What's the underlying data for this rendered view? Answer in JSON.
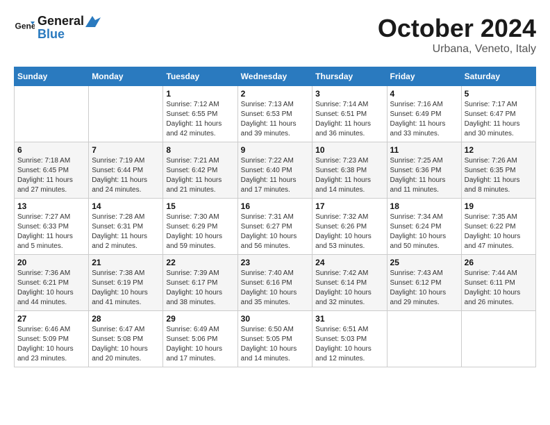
{
  "header": {
    "logo_line1": "General",
    "logo_line2": "Blue",
    "month": "October 2024",
    "location": "Urbana, Veneto, Italy"
  },
  "weekdays": [
    "Sunday",
    "Monday",
    "Tuesday",
    "Wednesday",
    "Thursday",
    "Friday",
    "Saturday"
  ],
  "weeks": [
    [
      {
        "day": "",
        "info": ""
      },
      {
        "day": "",
        "info": ""
      },
      {
        "day": "1",
        "info": "Sunrise: 7:12 AM\nSunset: 6:55 PM\nDaylight: 11 hours and 42 minutes."
      },
      {
        "day": "2",
        "info": "Sunrise: 7:13 AM\nSunset: 6:53 PM\nDaylight: 11 hours and 39 minutes."
      },
      {
        "day": "3",
        "info": "Sunrise: 7:14 AM\nSunset: 6:51 PM\nDaylight: 11 hours and 36 minutes."
      },
      {
        "day": "4",
        "info": "Sunrise: 7:16 AM\nSunset: 6:49 PM\nDaylight: 11 hours and 33 minutes."
      },
      {
        "day": "5",
        "info": "Sunrise: 7:17 AM\nSunset: 6:47 PM\nDaylight: 11 hours and 30 minutes."
      }
    ],
    [
      {
        "day": "6",
        "info": "Sunrise: 7:18 AM\nSunset: 6:45 PM\nDaylight: 11 hours and 27 minutes."
      },
      {
        "day": "7",
        "info": "Sunrise: 7:19 AM\nSunset: 6:44 PM\nDaylight: 11 hours and 24 minutes."
      },
      {
        "day": "8",
        "info": "Sunrise: 7:21 AM\nSunset: 6:42 PM\nDaylight: 11 hours and 21 minutes."
      },
      {
        "day": "9",
        "info": "Sunrise: 7:22 AM\nSunset: 6:40 PM\nDaylight: 11 hours and 17 minutes."
      },
      {
        "day": "10",
        "info": "Sunrise: 7:23 AM\nSunset: 6:38 PM\nDaylight: 11 hours and 14 minutes."
      },
      {
        "day": "11",
        "info": "Sunrise: 7:25 AM\nSunset: 6:36 PM\nDaylight: 11 hours and 11 minutes."
      },
      {
        "day": "12",
        "info": "Sunrise: 7:26 AM\nSunset: 6:35 PM\nDaylight: 11 hours and 8 minutes."
      }
    ],
    [
      {
        "day": "13",
        "info": "Sunrise: 7:27 AM\nSunset: 6:33 PM\nDaylight: 11 hours and 5 minutes."
      },
      {
        "day": "14",
        "info": "Sunrise: 7:28 AM\nSunset: 6:31 PM\nDaylight: 11 hours and 2 minutes."
      },
      {
        "day": "15",
        "info": "Sunrise: 7:30 AM\nSunset: 6:29 PM\nDaylight: 10 hours and 59 minutes."
      },
      {
        "day": "16",
        "info": "Sunrise: 7:31 AM\nSunset: 6:27 PM\nDaylight: 10 hours and 56 minutes."
      },
      {
        "day": "17",
        "info": "Sunrise: 7:32 AM\nSunset: 6:26 PM\nDaylight: 10 hours and 53 minutes."
      },
      {
        "day": "18",
        "info": "Sunrise: 7:34 AM\nSunset: 6:24 PM\nDaylight: 10 hours and 50 minutes."
      },
      {
        "day": "19",
        "info": "Sunrise: 7:35 AM\nSunset: 6:22 PM\nDaylight: 10 hours and 47 minutes."
      }
    ],
    [
      {
        "day": "20",
        "info": "Sunrise: 7:36 AM\nSunset: 6:21 PM\nDaylight: 10 hours and 44 minutes."
      },
      {
        "day": "21",
        "info": "Sunrise: 7:38 AM\nSunset: 6:19 PM\nDaylight: 10 hours and 41 minutes."
      },
      {
        "day": "22",
        "info": "Sunrise: 7:39 AM\nSunset: 6:17 PM\nDaylight: 10 hours and 38 minutes."
      },
      {
        "day": "23",
        "info": "Sunrise: 7:40 AM\nSunset: 6:16 PM\nDaylight: 10 hours and 35 minutes."
      },
      {
        "day": "24",
        "info": "Sunrise: 7:42 AM\nSunset: 6:14 PM\nDaylight: 10 hours and 32 minutes."
      },
      {
        "day": "25",
        "info": "Sunrise: 7:43 AM\nSunset: 6:12 PM\nDaylight: 10 hours and 29 minutes."
      },
      {
        "day": "26",
        "info": "Sunrise: 7:44 AM\nSunset: 6:11 PM\nDaylight: 10 hours and 26 minutes."
      }
    ],
    [
      {
        "day": "27",
        "info": "Sunrise: 6:46 AM\nSunset: 5:09 PM\nDaylight: 10 hours and 23 minutes."
      },
      {
        "day": "28",
        "info": "Sunrise: 6:47 AM\nSunset: 5:08 PM\nDaylight: 10 hours and 20 minutes."
      },
      {
        "day": "29",
        "info": "Sunrise: 6:49 AM\nSunset: 5:06 PM\nDaylight: 10 hours and 17 minutes."
      },
      {
        "day": "30",
        "info": "Sunrise: 6:50 AM\nSunset: 5:05 PM\nDaylight: 10 hours and 14 minutes."
      },
      {
        "day": "31",
        "info": "Sunrise: 6:51 AM\nSunset: 5:03 PM\nDaylight: 10 hours and 12 minutes."
      },
      {
        "day": "",
        "info": ""
      },
      {
        "day": "",
        "info": ""
      }
    ]
  ]
}
